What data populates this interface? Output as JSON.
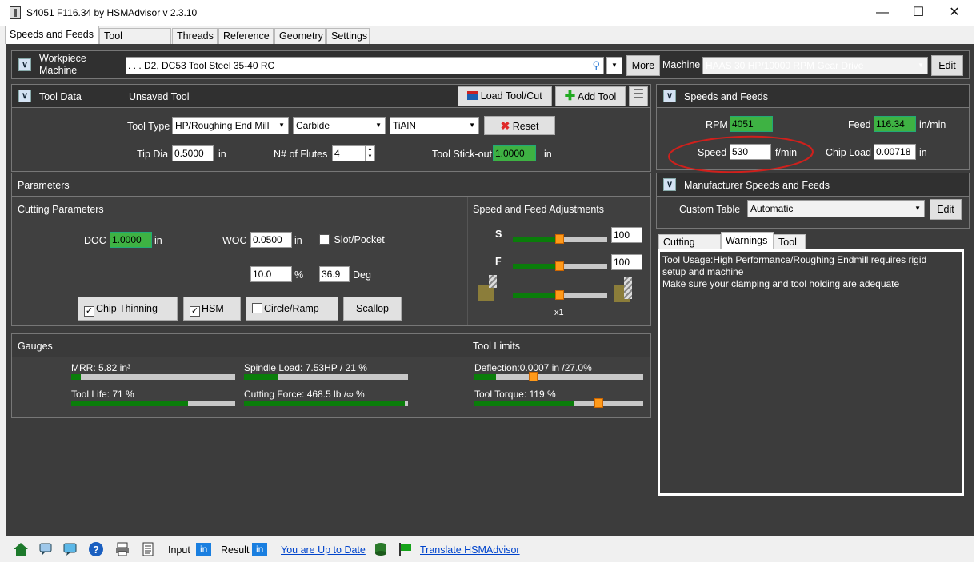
{
  "window": {
    "title": "S4051 F116.34 by HSMAdvisor v 2.3.10"
  },
  "tabs": [
    "Speeds and Feeds",
    "Tool Database",
    "Threads",
    "Reference",
    "Geometry",
    "Settings"
  ],
  "workpiece": {
    "label_line1": "Workpiece",
    "label_line2": "Machine",
    "value": ". . . D2, DC53 Tool Steel 35-40 RC",
    "more": "More",
    "machine_label": "Machine",
    "machine_value": "HAAS 30 HP/10000 RPM Gear Drive",
    "edit": "Edit"
  },
  "tool_data": {
    "header": "Tool Data",
    "name": "Unsaved Tool",
    "load_btn": "Load Tool/Cut",
    "add_btn": "Add Tool",
    "tool_type_label": "Tool Type",
    "tool_type": "HP/Roughing End Mill",
    "material": "Carbide",
    "coating": "TiAlN",
    "reset": "Reset",
    "tip_dia_label": "Tip Dia",
    "tip_dia": "0.5000",
    "tip_dia_unit": "in",
    "flutes_label": "N# of Flutes",
    "flutes": "4",
    "stickout_label": "Tool Stick-out",
    "stickout": "1.0000",
    "stickout_unit": "in"
  },
  "parameters": {
    "header": "Parameters",
    "cutting_header": "Cutting Parameters",
    "doc_label": "DOC",
    "doc": "1.0000",
    "doc_unit": "in",
    "woc_label": "WOC",
    "woc": "0.0500",
    "woc_unit": "in",
    "slot_label": "Slot/Pocket",
    "woc_pct": "10.0",
    "pct_unit": "%",
    "deg": "36.9",
    "deg_unit": "Deg",
    "chip_thinning": "Chip Thinning",
    "hsm": "HSM",
    "circle_ramp": "Circle/Ramp",
    "scallop": "Scallop",
    "adj_header": "Speed and Feed Adjustments",
    "s_label": "S",
    "s_value": "100",
    "f_label": "F",
    "f_value": "100",
    "multiplier": "x1",
    "s_level": 0.5,
    "f_level": 0.5,
    "tool_level": 0.5
  },
  "gauges": {
    "header": "Gauges",
    "limits_header": "Tool Limits",
    "mrr": "MRR: 5.82 in³",
    "mrr_level": 0.06,
    "spindle": "Spindle Load: 7.53HP / 21 %",
    "spindle_level": 0.21,
    "life": "Tool Life: 71 %",
    "life_level": 0.71,
    "force": "Cutting Force: 468.5 lb /∞ %",
    "force_level": 0.98,
    "deflection": "Deflection:0.0007 in /27.0%",
    "deflection_level": 0.13,
    "deflection_marker": 0.35,
    "torque": "Tool Torque: 119 %",
    "torque_level": 0.59,
    "torque_marker": 0.74
  },
  "speeds": {
    "header": "Speeds and Feeds",
    "rpm_label": "RPM",
    "rpm": "4051",
    "feed_label": "Feed",
    "feed": "116.34",
    "feed_unit": "in/min",
    "speed_label": "Speed",
    "speed": "530",
    "speed_unit": "f/min",
    "chip_label": "Chip Load",
    "chip": "0.00718",
    "chip_unit": "in"
  },
  "manufacturer": {
    "header": "Manufacturer Speeds and Feeds",
    "table_label": "Custom Table",
    "table_value": "Automatic",
    "edit": "Edit"
  },
  "info_tabs": [
    "Cutting Data",
    "Warnings",
    "Tool"
  ],
  "warnings": [
    "Tool Usage:High Performance/Roughing Endmill requires rigid",
    "setup and machine",
    "Make sure your clamping and tool holding are adequate"
  ],
  "status": {
    "input_label": "Input",
    "input_unit": "in",
    "result_label": "Result",
    "result_unit": "in",
    "uptodate": "You are Up to Date",
    "translate": "Translate HSMAdvisor"
  },
  "colors": {
    "panel": "#3c3c3c",
    "header": "#303030",
    "green": "#3eb243",
    "bar_fill": "#0a7d0a",
    "knob": "#ff9a1a",
    "annotation": "#d0201c"
  }
}
